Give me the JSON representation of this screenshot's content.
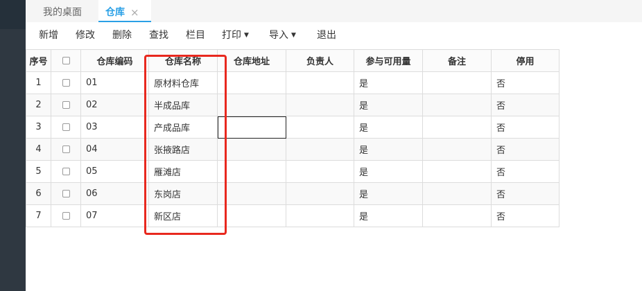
{
  "tabs": {
    "home": "我的桌面",
    "active": "仓库",
    "close_icon": "×"
  },
  "toolbar": {
    "add": "新增",
    "edit": "修改",
    "delete": "删除",
    "find": "查找",
    "columns": "栏目",
    "print": "打印",
    "import": "导入",
    "exit": "退出",
    "caret": "▼"
  },
  "table": {
    "headers": [
      "序号",
      "",
      "仓库编码",
      "仓库名称",
      "仓库地址",
      "负责人",
      "参与可用量",
      "备注",
      "停用"
    ],
    "rows": [
      [
        "1",
        "",
        "01",
        "原材料仓库",
        "",
        "",
        "是",
        "",
        "否"
      ],
      [
        "2",
        "",
        "02",
        "半成品库",
        "",
        "",
        "是",
        "",
        "否"
      ],
      [
        "3",
        "",
        "03",
        "产成品库",
        "",
        "",
        "是",
        "",
        "否"
      ],
      [
        "4",
        "",
        "04",
        "张掖路店",
        "",
        "",
        "是",
        "",
        "否"
      ],
      [
        "5",
        "",
        "05",
        "雁滩店",
        "",
        "",
        "是",
        "",
        "否"
      ],
      [
        "6",
        "",
        "06",
        "东岗店",
        "",
        "",
        "是",
        "",
        "否"
      ],
      [
        "7",
        "",
        "07",
        "新区店",
        "",
        "",
        "是",
        "",
        "否"
      ]
    ]
  },
  "colors": {
    "accent": "#2aa0e6",
    "highlight": "#e8281e",
    "sidebar": "#2f3841"
  }
}
